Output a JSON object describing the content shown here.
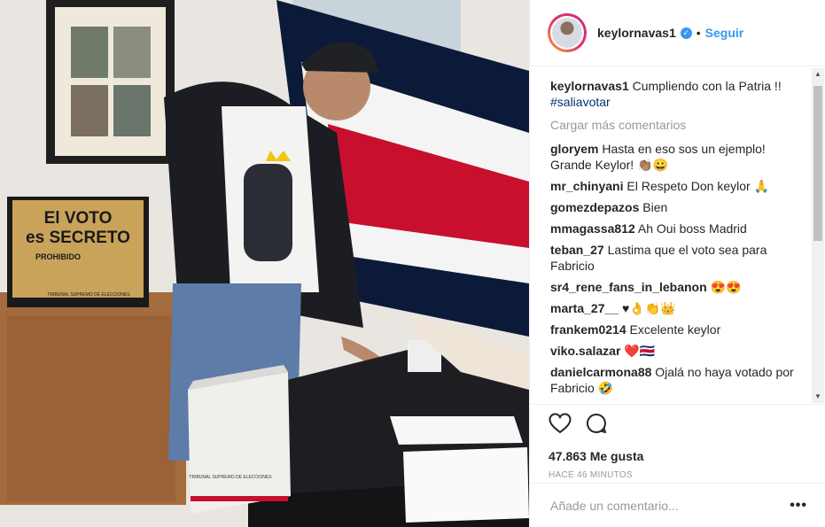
{
  "post": {
    "username": "keylornavas1",
    "follow_label": "Seguir",
    "separator": "•",
    "verified_glyph": "✓"
  },
  "caption": {
    "username": "keylornavas1",
    "text": "Cumpliendo con la Patria !!",
    "hashtag": "#saliavotar"
  },
  "load_more": "Cargar más comentarios",
  "comments": [
    {
      "user": "gloryem",
      "text": "Hasta en eso sos un ejemplo! Grande Keylor! 👏🏽😀"
    },
    {
      "user": "mr_chinyani",
      "text": "El Respeto Don keylor 🙏"
    },
    {
      "user": "gomezdepazos",
      "text": "Bien"
    },
    {
      "user": "mmagassa812",
      "text": "Ah Oui boss Madrid"
    },
    {
      "user": "teban_27",
      "text": "Lastima que el voto sea para Fabricio"
    },
    {
      "user": "sr4_rene_fans_in_lebanon",
      "text": "😍😍"
    },
    {
      "user": "marta_27__",
      "text": "♥👌👏👑"
    },
    {
      "user": "frankem0214",
      "text": "Excelente keylor"
    },
    {
      "user": "viko.salazar",
      "text": "❤️🇨🇷"
    },
    {
      "user": "danielcarmona88",
      "text": "Ojalá no haya votado por Fabricio 🤣"
    }
  ],
  "likes": "47.863 Me gusta",
  "time_ago": "HACE 46 MINUTOS",
  "add_comment_placeholder": "Añade un comentario...",
  "more_glyph": "•••",
  "photo": {
    "sign_line1": "El VOTO",
    "sign_line2": "es SECRETO",
    "sign_prohibido": "PROHIBIDO",
    "sign_footer": "TRIBUNAL SUPREMO DE ELECCIONES",
    "box_label": "TRIBUNAL SUPREMO DE ELECCIONES"
  },
  "colors": {
    "link_blue": "#3897f0",
    "hashtag": "#003569",
    "flag_blue": "#0c1a3a",
    "flag_red": "#c8102e"
  }
}
